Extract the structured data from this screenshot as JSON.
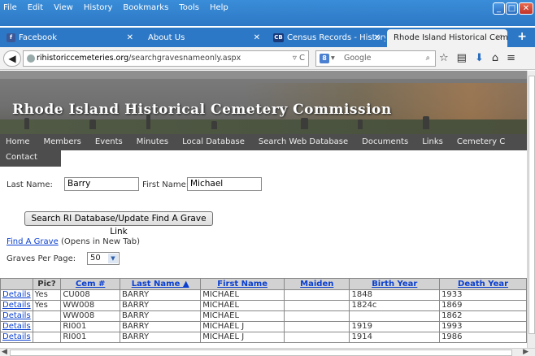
{
  "menu": [
    "File",
    "Edit",
    "View",
    "History",
    "Bookmarks",
    "Tools",
    "Help"
  ],
  "tabs": [
    {
      "label": "Facebook",
      "icon": "facebook-icon",
      "color": "#3b5998",
      "glyph": "f"
    },
    {
      "label": "About Us"
    },
    {
      "label": "Census Records - History -...",
      "icon": "cb-icon",
      "color": "#1a3a7a",
      "glyph": "CB"
    },
    {
      "label": "Rhode Island Historical Cemete..."
    }
  ],
  "url": {
    "domain": "rihistoriccemeteries.org",
    "path": "/searchgravesnameonly.aspx"
  },
  "search_placeholder": "Google",
  "site": {
    "title": "Rhode Island Historical Cemetery Commission",
    "nav": [
      "Home",
      "Members",
      "Events",
      "Minutes",
      "Local Database",
      "Search Web Database",
      "Documents",
      "Links",
      "Cemetery C"
    ],
    "nav2": "Contact"
  },
  "form": {
    "last_name_label": "Last Name:",
    "last_name_value": "Barry",
    "first_name_label": "First Name:",
    "first_name_value": "Michael",
    "search_button": "Search RI Database/Update Find A Grave Link",
    "find_a_grave_link": "Find A Grave",
    "find_a_grave_note": "(Opens in New Tab)",
    "graves_per_page_label": "Graves Per Page:",
    "graves_per_page_value": "50"
  },
  "table": {
    "headers": [
      "",
      "Pic?",
      "Cem #",
      "Last Name ▲",
      "First Name",
      "Maiden",
      "Birth Year",
      "Death Year"
    ],
    "rows": [
      [
        "Details",
        "Yes",
        "CU008",
        "BARRY",
        "MICHAEL",
        "",
        "1848",
        "1933"
      ],
      [
        "Details",
        "Yes",
        "WW008",
        "BARRY",
        "MICHAEL",
        "",
        "1824c",
        "1869"
      ],
      [
        "Details",
        "",
        "WW008",
        "BARRY",
        "MICHAEL",
        "",
        "",
        "1862"
      ],
      [
        "Details",
        "",
        "RI001",
        "BARRY",
        "MICHAEL J",
        "",
        "1919",
        "1993"
      ],
      [
        "Details",
        "",
        "RI001",
        "BARRY",
        "MICHAEL J",
        "",
        "1914",
        "1986"
      ]
    ]
  }
}
